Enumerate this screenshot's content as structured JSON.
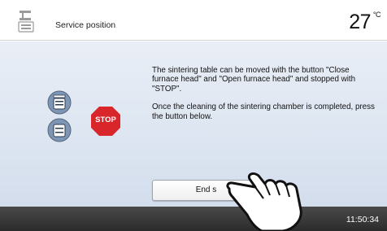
{
  "header": {
    "title": "Service position",
    "temperature": "27",
    "temperature_unit": "°C",
    "icon": "furnace-icon"
  },
  "panel": {
    "icons": {
      "close_furnace": "close-furnace-head-icon",
      "open_furnace": "open-furnace-head-icon",
      "stop": "stop-icon"
    },
    "stop_label": "STOP",
    "instruction_paragraph_1": "The sintering table can be moved with the button \"Close furnace head\" and \"Open furnace head\" and stopped with \"STOP\".",
    "instruction_paragraph_2": "Once the cleaning of the sintering chamber is completed, press the button below.",
    "end_button_label": "End s"
  },
  "footer": {
    "clock": "11:50:34"
  },
  "colors": {
    "stop_red": "#d8262b",
    "chamber_blue": "#7e96b6",
    "content_bg": "#dce5f1",
    "footer_bg": "#333333"
  }
}
